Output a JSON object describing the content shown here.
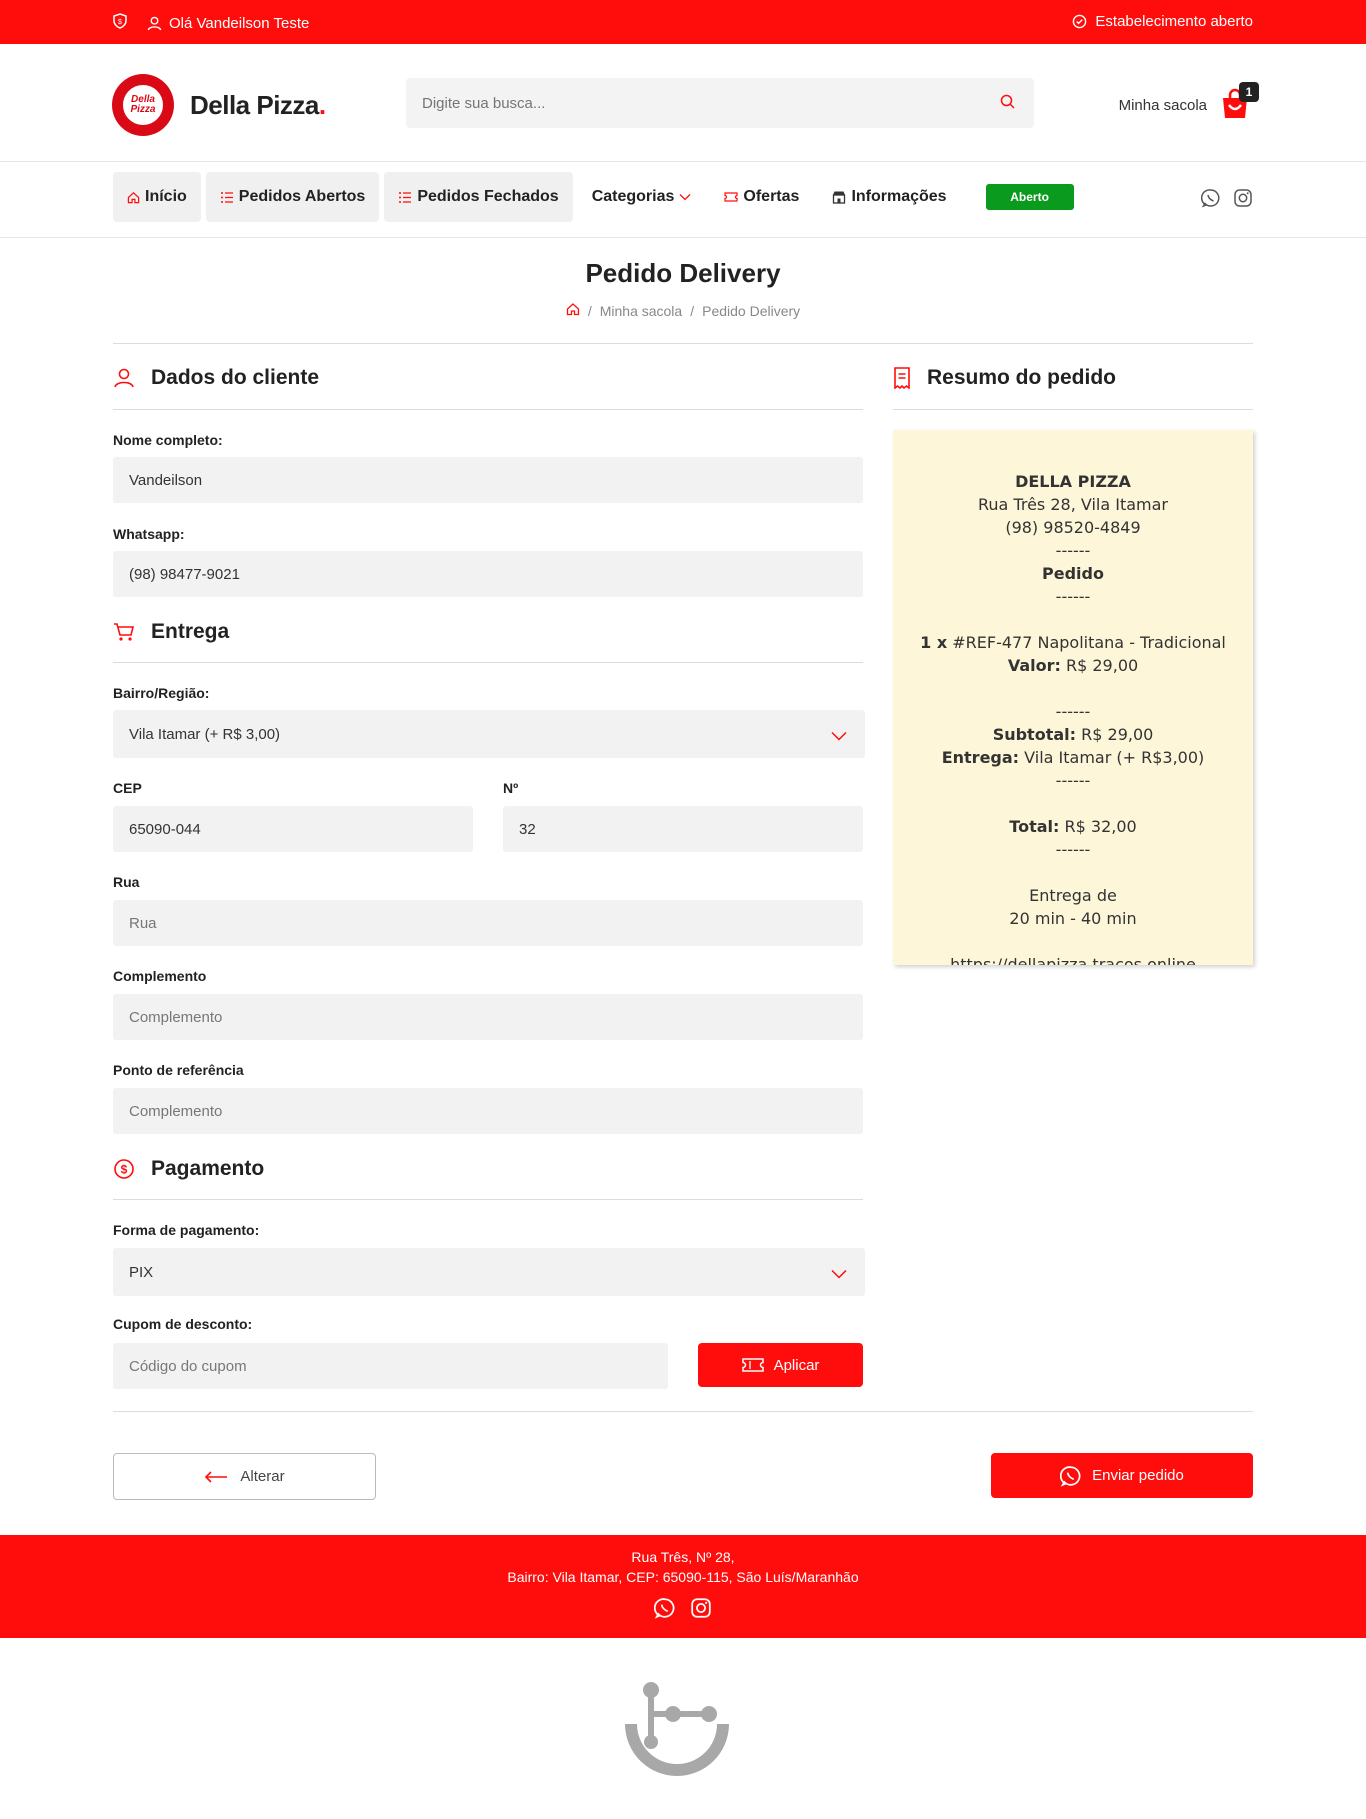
{
  "topbar": {
    "greeting": "Olá Vandeilson Teste",
    "status": "Estabelecimento aberto"
  },
  "header": {
    "logo_badge_line1": "Della",
    "logo_badge_line2": "Pizza",
    "brand": "Della Pizza",
    "brand_dot": ".",
    "search_placeholder": "Digite sua busca...",
    "cart_label": "Minha sacola",
    "cart_count": "1"
  },
  "nav": {
    "items": [
      {
        "label": "Início",
        "icon": "home-icon"
      },
      {
        "label": "Pedidos Abertos",
        "icon": "list-icon"
      },
      {
        "label": "Pedidos Fechados",
        "icon": "list-icon"
      },
      {
        "label": "Categorias",
        "icon": "chevron-down-icon"
      },
      {
        "label": "Ofertas",
        "icon": "ticket-icon"
      },
      {
        "label": "Informações",
        "icon": "store-icon"
      }
    ],
    "status_badge": "Aberto"
  },
  "page": {
    "title": "Pedido Delivery",
    "breadcrumb": [
      "Minha sacola",
      "Pedido Delivery"
    ]
  },
  "cliente": {
    "heading": "Dados do cliente",
    "nome_label": "Nome completo:",
    "nome_value": "Vandeilson",
    "whatsapp_label": "Whatsapp:",
    "whatsapp_value": "(98) 98477-9021"
  },
  "entrega": {
    "heading": "Entrega",
    "bairro_label": "Bairro/Região:",
    "bairro_value": "Vila Itamar (+ R$ 3,00)",
    "cep_label": "CEP",
    "cep_value": "65090-044",
    "numero_label": "Nº",
    "numero_value": "32",
    "rua_label": "Rua",
    "rua_placeholder": "Rua",
    "complemento_label": "Complemento",
    "complemento_placeholder": "Complemento",
    "referencia_label": "Ponto de referência",
    "referencia_placeholder": "Complemento"
  },
  "pagamento": {
    "heading": "Pagamento",
    "forma_label": "Forma de pagamento:",
    "forma_value": "PIX",
    "cupom_label": "Cupom de desconto:",
    "cupom_placeholder": "Código do cupom",
    "aplicar_label": "Aplicar"
  },
  "resumo": {
    "heading": "Resumo do pedido",
    "store_name": "DELLA PIZZA",
    "store_address": "Rua Três 28, Vila Itamar",
    "store_phone": "(98) 98520-4849",
    "separator": "------",
    "pedido_label": "Pedido",
    "item_qty": "1 x",
    "item_name": "#REF-477 Napolitana - Tradicional",
    "valor_label": "Valor:",
    "valor_value": "R$ 29,00",
    "subtotal_label": "Subtotal:",
    "subtotal_value": "R$ 29,00",
    "entrega_label": "Entrega:",
    "entrega_value": "Vila Itamar (+ R$3,00)",
    "total_label": "Total:",
    "total_value": "R$ 32,00",
    "tempo_line1": "Entrega de",
    "tempo_line2": "20 min - 40 min",
    "url": "https://dellapizza.tracos.online"
  },
  "actions": {
    "alterar_label": "Alterar",
    "enviar_label": "Enviar pedido"
  },
  "footer": {
    "line1": "Rua Três, Nº 28,",
    "line2": "Bairro: Vila Itamar, CEP: 65090-115, São Luís/Maranhão"
  },
  "colors": {
    "primary": "#ff0d0d",
    "status_green": "#0a9a1d",
    "receipt_bg": "#fdf6d8"
  }
}
